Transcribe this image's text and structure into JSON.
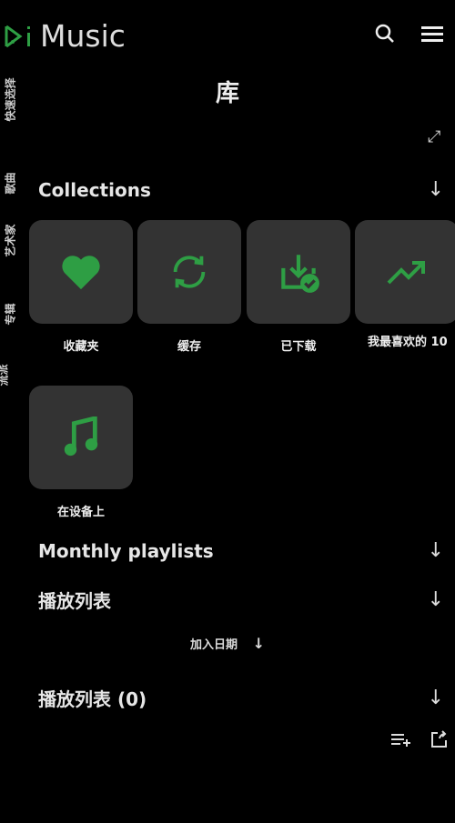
{
  "app": {
    "title": "Music",
    "accent": "#2e9e44"
  },
  "header": {
    "search_icon": "search-icon",
    "menu_icon": "menu-icon"
  },
  "sidebar": {
    "items": [
      {
        "label": "快速选择"
      },
      {
        "label": "歌曲"
      },
      {
        "label": "艺术家"
      },
      {
        "label": "专辑"
      },
      {
        "label": "流派"
      }
    ]
  },
  "page": {
    "title": "库"
  },
  "collections": {
    "title": "Collections",
    "items": [
      {
        "label": "收藏夹",
        "icon": "heart-icon"
      },
      {
        "label": "缓存",
        "icon": "sync-icon"
      },
      {
        "label": "已下载",
        "icon": "download-done-icon"
      },
      {
        "label": "我最喜欢的 10",
        "icon": "trending-up-icon"
      },
      {
        "label": "在设备上",
        "icon": "music-note-icon"
      }
    ]
  },
  "monthly": {
    "title": "Monthly playlists"
  },
  "playlists": {
    "title": "播放列表",
    "sort_label": "加入日期"
  },
  "playlists_count": {
    "title": "播放列表 (0)"
  }
}
